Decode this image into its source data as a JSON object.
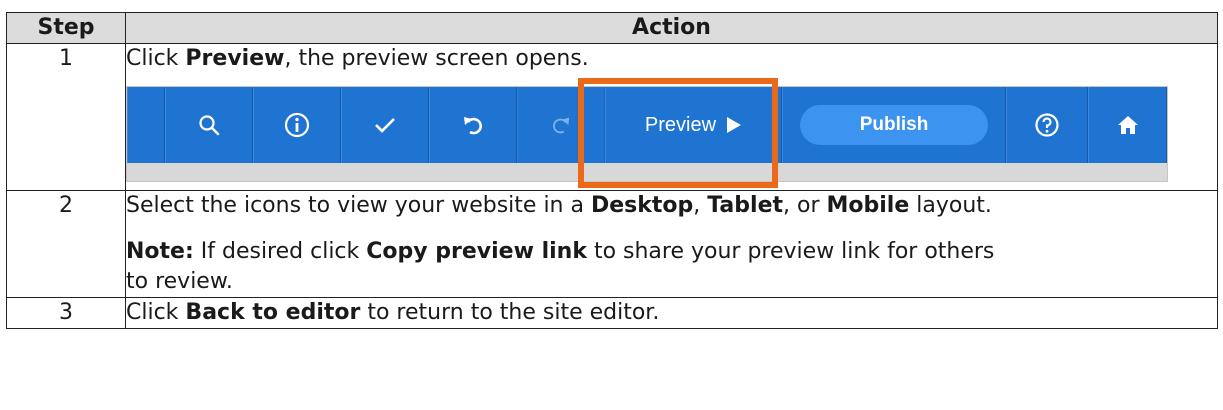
{
  "headers": {
    "step": "Step",
    "action": "Action"
  },
  "rows": [
    {
      "step": "1",
      "text": {
        "pre": "Click ",
        "bold": "Preview",
        "post": ", the preview screen opens."
      }
    },
    {
      "step": "2",
      "text": {
        "p1": "Select the icons to view your website in a ",
        "b1": "Desktop",
        "p2": ", ",
        "b2": "Tablet",
        "p3": ", or ",
        "b3": "Mobile",
        "p4": " layout."
      },
      "note": {
        "label": "Note:",
        "p1": " If desired click ",
        "b1": "Copy preview link",
        "p2": " to share your preview link for others",
        "p3": "to review."
      }
    },
    {
      "step": "3",
      "text": {
        "pre": "Click ",
        "bold": "Back to editor",
        "post": " to return to the site editor."
      }
    }
  ],
  "toolbar": {
    "icons": [
      "search-icon",
      "info-icon",
      "check-icon",
      "undo-icon",
      "redo-icon",
      "play-icon",
      "help-icon",
      "home-icon"
    ],
    "preview_label": "Preview",
    "publish_label": "Publish",
    "highlight_color": "#ea6a1a",
    "bar_color": "#1f73d1"
  }
}
